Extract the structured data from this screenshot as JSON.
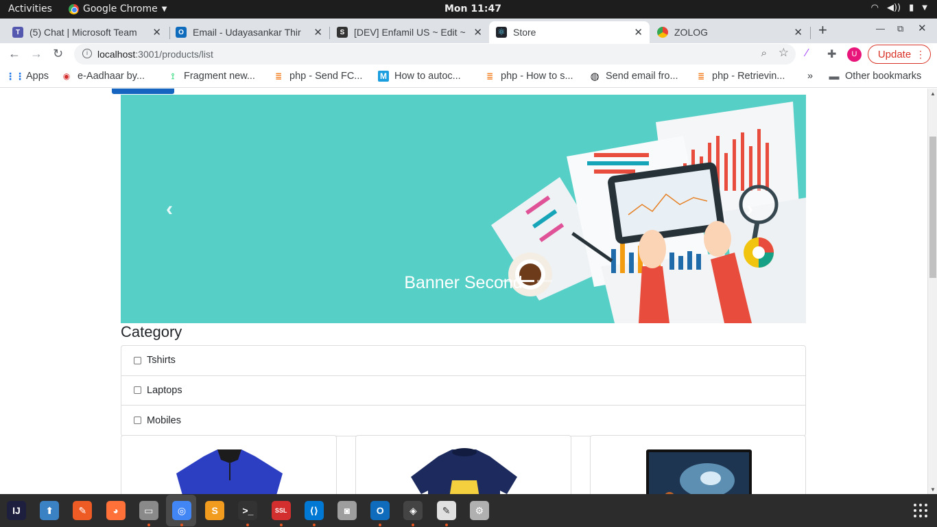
{
  "topbar": {
    "activities": "Activities",
    "app_name": "Google Chrome",
    "clock": "Mon 11:47"
  },
  "tabs": [
    {
      "label": "(5) Chat | Microsoft Team",
      "icon": "teams-icon",
      "color": "#5558af"
    },
    {
      "label": "Email - Udayasankar Thir",
      "icon": "outlook-icon",
      "color": "#0f6cbd"
    },
    {
      "label": "[DEV] Enfamil US ~ Edit ~",
      "icon": "shopify-icon",
      "color": "#333333"
    },
    {
      "label": "Store",
      "icon": "react-icon",
      "color": "#20232a",
      "active": true
    },
    {
      "label": "ZOLOG",
      "icon": "chrome-icon",
      "color": "#4285f4"
    }
  ],
  "toolbar": {
    "url_host": "localhost",
    "url_path": ":3001/products/list",
    "update_label": "Update",
    "profile_initial": "U"
  },
  "bookmarks": [
    {
      "label": "Apps",
      "icon": "apps-grid-icon"
    },
    {
      "label": "e-Aadhaar by...",
      "icon": "aadhaar-icon"
    },
    {
      "label": "Fragment new...",
      "icon": "android-icon"
    },
    {
      "label": "php - Send FC...",
      "icon": "stackoverflow-icon"
    },
    {
      "label": "How to autoc...",
      "icon": "medium-icon"
    },
    {
      "label": "php - How to s...",
      "icon": "stackoverflow-icon"
    },
    {
      "label": "Send email fro...",
      "icon": "globe-icon"
    },
    {
      "label": "php - Retrievin...",
      "icon": "stackoverflow-icon"
    }
  ],
  "bookmarks_overflow": "»",
  "other_bookmarks": "Other bookmarks",
  "page": {
    "banner_caption": "Banner Second",
    "category_title": "Category",
    "categories": [
      "Tshirts",
      "Laptops",
      "Mobiles"
    ]
  },
  "dock": [
    {
      "name": "intellij-icon",
      "color": "#1e1e3f"
    },
    {
      "name": "software-updater-icon",
      "color": "#3b82c4"
    },
    {
      "name": "postman-icon",
      "color": "#ef5b25"
    },
    {
      "name": "firefox-icon",
      "color": "#ff7139"
    },
    {
      "name": "file-manager-icon",
      "color": "#8a8a8a"
    },
    {
      "name": "chrome-icon",
      "color": "#4285f4",
      "active": true
    },
    {
      "name": "sublime-text-icon",
      "color": "#f29c1f"
    },
    {
      "name": "terminal-icon",
      "color": "#333333"
    },
    {
      "name": "ssl-vpn-icon",
      "color": "#d32f2f"
    },
    {
      "name": "vscode-icon",
      "color": "#0078d4"
    },
    {
      "name": "screenshot-icon",
      "color": "#9e9e9e"
    },
    {
      "name": "outlook-icon",
      "color": "#0f6cbd"
    },
    {
      "name": "unity-icon",
      "color": "#444444"
    },
    {
      "name": "text-editor-icon",
      "color": "#e0e0e0"
    },
    {
      "name": "settings-icon",
      "color": "#b0b0b0"
    }
  ],
  "colors": {
    "banner_bg": "#56cfc6",
    "update_red": "#d93025",
    "accent_blue": "#1565c0"
  }
}
